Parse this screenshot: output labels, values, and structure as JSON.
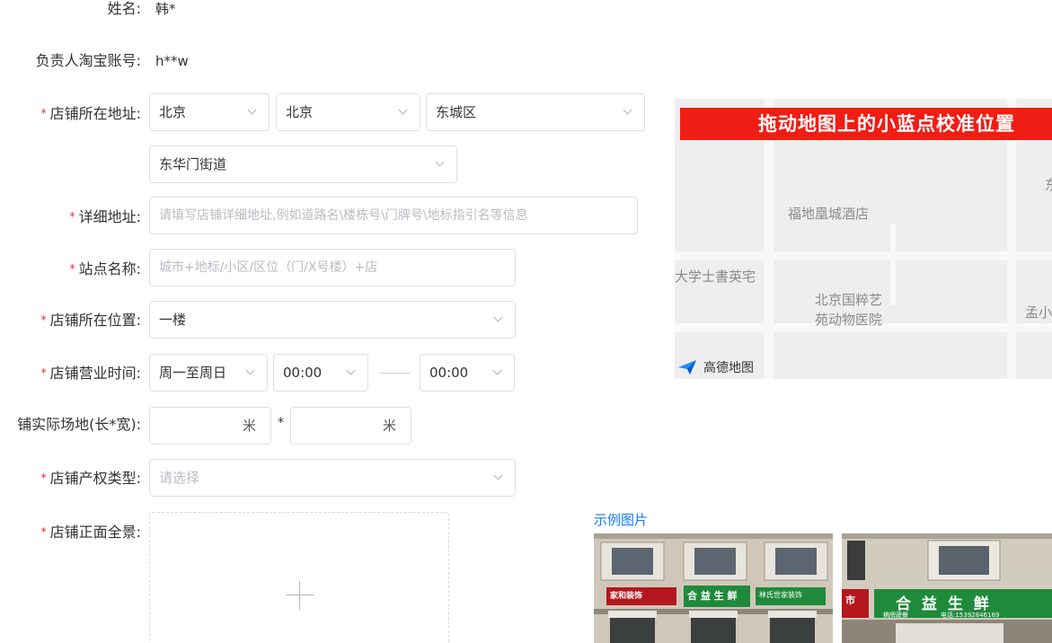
{
  "form": {
    "name_label": "姓名:",
    "name_value": "韩*",
    "taobao_label": "负责人淘宝账号:",
    "taobao_value": "h**w",
    "address_label": "店铺所在地址:",
    "province": "北京",
    "city": "北京",
    "district": "东城区",
    "street": "东华门街道",
    "detail_label": "详细地址:",
    "detail_placeholder": "请填写店铺详细地址,例如道路名\\楼栋号\\门牌号\\地标指引名等信息",
    "station_label": "站点名称:",
    "station_placeholder": "城市+地标/小区/区位（门/X号楼）+店",
    "floor_label": "店铺所在位置:",
    "floor_value": "一楼",
    "hours_label": "店铺营业时间:",
    "hours_days": "周一至周日",
    "hours_start": "00:00",
    "hours_end": "00:00",
    "area_label": "铺实际场地(长*宽):",
    "area_unit": "米",
    "area_sep": "*",
    "property_label": "店铺产权类型:",
    "property_placeholder": "请选择",
    "photo_label": "店铺正面全景:",
    "required_mark": "*"
  },
  "map": {
    "banner": "拖动地图上的小蓝点校准位置",
    "poi_hotel": "福地凰城酒店",
    "poi_residence": "大学士書英宅",
    "poi_hospital_1": "北京国粹艺",
    "poi_hospital_2": "苑动物医院",
    "poi_right_1": "东",
    "poi_right_2": "孟小",
    "logo_text": "高德地图"
  },
  "sample": {
    "link": "示例图片",
    "shop1_sign_left": "家和装饰",
    "shop1_sign_mid": "合 益 生 鲜",
    "shop1_sign_right": "林氏世家装饰",
    "shop2_sign_left": "市",
    "shop2_sign_main": "合 益 生 鲜",
    "shop2_sign_sub1": "稿牌蔬餐",
    "shop2_sign_sub2": "电话:15392846169"
  },
  "colors": {
    "required": "#f5222d",
    "banner": "#f01d14",
    "link": "#1677ff",
    "sign_green": "#1f8a3b"
  },
  "icons": [
    "chevron-down-icon",
    "plus-icon",
    "amap-logo-icon"
  ]
}
